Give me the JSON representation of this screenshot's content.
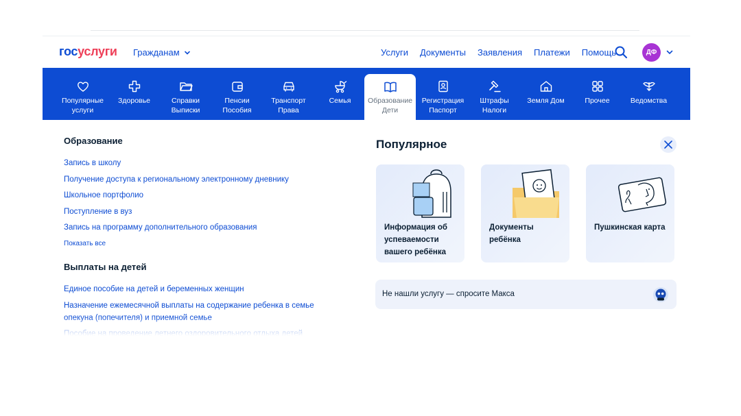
{
  "header": {
    "logo_part1": "гос",
    "logo_part2": "услуги",
    "audience": "Гражданам",
    "nav": [
      "Услуги",
      "Документы",
      "Заявления",
      "Платежи",
      "Помощь"
    ],
    "avatar_initials": "ДФ"
  },
  "categories": [
    {
      "label": "Популярные\nуслуги",
      "icon": "heart-icon"
    },
    {
      "label": "Здоровье",
      "icon": "medical-cross-icon"
    },
    {
      "label": "Справки\nВыписки",
      "icon": "folder-icon"
    },
    {
      "label": "Пенсии\nПособия",
      "icon": "wallet-icon"
    },
    {
      "label": "Транспорт\nПрава",
      "icon": "car-icon"
    },
    {
      "label": "Семья",
      "icon": "stroller-icon"
    },
    {
      "label": "Образование\nДети",
      "icon": "book-icon"
    },
    {
      "label": "Регистрация\nПаспорт",
      "icon": "passport-icon"
    },
    {
      "label": "Штрафы\nНалоги",
      "icon": "gavel-icon"
    },
    {
      "label": "Земля Дом",
      "icon": "house-icon"
    },
    {
      "label": "Прочее",
      "icon": "grid-icon"
    },
    {
      "label": "Ведомства",
      "icon": "emblem-icon"
    }
  ],
  "active_category": "Образование\nДети",
  "education": {
    "title": "Образование",
    "links": [
      "Запись в школу",
      "Получение доступа к региональному электронному дневнику",
      "Школьное портфолио",
      "Поступление в вуз",
      "Запись на программу дополнительного образования"
    ],
    "show_all": "Показать все"
  },
  "payments": {
    "title": "Выплаты на детей",
    "links": [
      "Единое пособие на детей и беременных женщин",
      "Назначение ежемесячной выплаты на содержание ребенка в семье опекуна (попечителя) и приемной семье",
      "Пособие на проведение летнего оздоровительного отдыха детей"
    ]
  },
  "popular": {
    "title": "Популярное",
    "cards": [
      {
        "text": "Информация об успеваемости вашего ребёнка",
        "icon": "backpack-icon"
      },
      {
        "text": "Документы ребёнка",
        "icon": "child-documents-icon"
      },
      {
        "text": "Пушкинская карта",
        "icon": "pushkin-card-icon"
      }
    ]
  },
  "ask_max": "Не нашли услугу — спросите Макса",
  "colors": {
    "brand_blue": "#0d4cd3",
    "brand_red": "#ee3f58",
    "avatar": "#a834d4"
  }
}
